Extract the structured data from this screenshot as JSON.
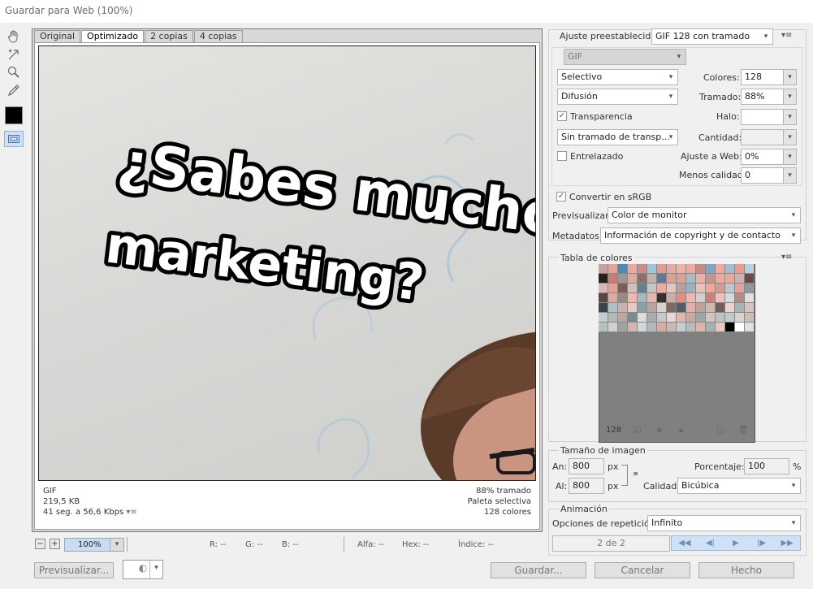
{
  "window": {
    "title": "Guardar para Web (100%)"
  },
  "tabs": [
    "Original",
    "Optimizado",
    "2 copias",
    "4 copias"
  ],
  "image": {
    "headline_line1": "¿Sabes mucho",
    "headline_line2": "marketing?"
  },
  "preview_info": {
    "format": "GIF",
    "size": "219,5 KB",
    "time": "41 seg. a 56,6 Kbps",
    "dither_pct": "88% tramado",
    "palette": "Paleta selectiva",
    "colors": "128 colores"
  },
  "status": {
    "zoom": "100%",
    "r": "R: --",
    "g": "G: --",
    "b": "B: --",
    "alpha": "Alfa: --",
    "hex": "Hex: --",
    "index": "Índice: --"
  },
  "buttons": {
    "preview": "Previsualizar...",
    "save": "Guardar...",
    "cancel": "Cancelar",
    "done": "Hecho"
  },
  "settings": {
    "preset_label": "Ajuste preestablecido:",
    "preset_value": "GIF 128 con tramado",
    "format": "GIF",
    "reduction": "Selectivo",
    "colors_label": "Colores:",
    "colors_value": "128",
    "dither_algo": "Difusión",
    "dither_label": "Tramado:",
    "dither_value": "88%",
    "transparency_label": "Transparencia",
    "matte_label": "Halo:",
    "matte_value": "",
    "transp_dither": "Sin tramado de transp...",
    "amount_label": "Cantidad:",
    "amount_value": "",
    "interlaced_label": "Entrelazado",
    "web_snap_label": "Ajuste a Web:",
    "web_snap_value": "0%",
    "lossy_label": "Menos calidad:",
    "lossy_value": "0",
    "srgb_label": "Convertir en sRGB",
    "preview_label": "Previsualizar:",
    "preview_value": "Color de monitor",
    "metadata_label": "Metadatos:",
    "metadata_value": "Información de copyright y de contacto"
  },
  "color_table": {
    "title": "Tabla de colores",
    "count": "128",
    "swatches": [
      "#c9a1a0",
      "#e8a398",
      "#4d89b5",
      "#e9a9a0",
      "#d08b88",
      "#9fc7dc",
      "#e49b8f",
      "#e4aca4",
      "#f3b1a8",
      "#f4a79b",
      "#c98a85",
      "#7fa6c4",
      "#f0a99e",
      "#9fbdd3",
      "#e99c8f",
      "#b9d2e0",
      "#2a1f1f",
      "#c97c6f",
      "#a0968f",
      "#e3a89d",
      "#8a6f6b",
      "#c2b0aa",
      "#5f7a91",
      "#d9a295",
      "#dba196",
      "#a8bcc8",
      "#e8b2a8",
      "#c5968d",
      "#ecaaa0",
      "#f0a69a",
      "#cdb3ad",
      "#6b4a44",
      "#d9b8b2",
      "#ee9d8f",
      "#7f5c55",
      "#d4c0ba",
      "#6a7e8d",
      "#c4c6c4",
      "#f2aa9f",
      "#e4c6bf",
      "#b7a19b",
      "#9cb2c0",
      "#edc0b7",
      "#f4a59a",
      "#d89a8f",
      "#b9c9d1",
      "#e2a49a",
      "#8c9aa3",
      "#5a4541",
      "#dbaaa3",
      "#9b8983",
      "#f3b6ad",
      "#a5b8c1",
      "#e7b6ac",
      "#3a3030",
      "#c8b0a9",
      "#e98b7e",
      "#f1b7ae",
      "#d2d0cd",
      "#cf7f74",
      "#efc0b6",
      "#d4d9db",
      "#b38b84",
      "#e6ddd9",
      "#3f4347",
      "#aec0c9",
      "#ceb0aa",
      "#e6c9c3",
      "#899ea9",
      "#b8a5a0",
      "#ddd0cb",
      "#7c6964",
      "#4e5e68",
      "#e0b1a8",
      "#c3a19b",
      "#d0b7b0",
      "#6f605c",
      "#efd2cc",
      "#a9b3b6",
      "#d8c4be",
      "#c4cdd0",
      "#b2b9b7",
      "#c0a6a0",
      "#7a8c94",
      "#dddcd9",
      "#a4aeac",
      "#c1cbc7",
      "#e8d6d1",
      "#e5b4aa",
      "#caa9a3",
      "#9aa7ab",
      "#d2c4bf",
      "#c0c4c1",
      "#bfcbcc",
      "#dad4d1",
      "#cdbdb8",
      "#b7c1bf",
      "#cfd4cf",
      "#9ca4a2",
      "#d3b6ae",
      "#cfd7d8",
      "#aeb9bb",
      "#e0a899",
      "#c9b9b4",
      "#c0d0ce",
      "#b9bbb6",
      "#ddb4aa",
      "#a3b2b1",
      "#e8c7bf",
      "#000000",
      "#ffffff",
      "#e0e0e0"
    ]
  },
  "image_size": {
    "title": "Tamaño de imagen",
    "width_label": "An:",
    "width_value": "800",
    "height_label": "Al:",
    "height_value": "800",
    "unit": "px",
    "percent_label": "Porcentaje:",
    "percent_value": "100",
    "percent_unit": "%",
    "quality_label": "Calidad:",
    "quality_value": "Bicúbica"
  },
  "animation": {
    "title": "Animación",
    "loop_label": "Opciones de repetición:",
    "loop_value": "Infinito",
    "frame_counter": "2 de 2"
  }
}
